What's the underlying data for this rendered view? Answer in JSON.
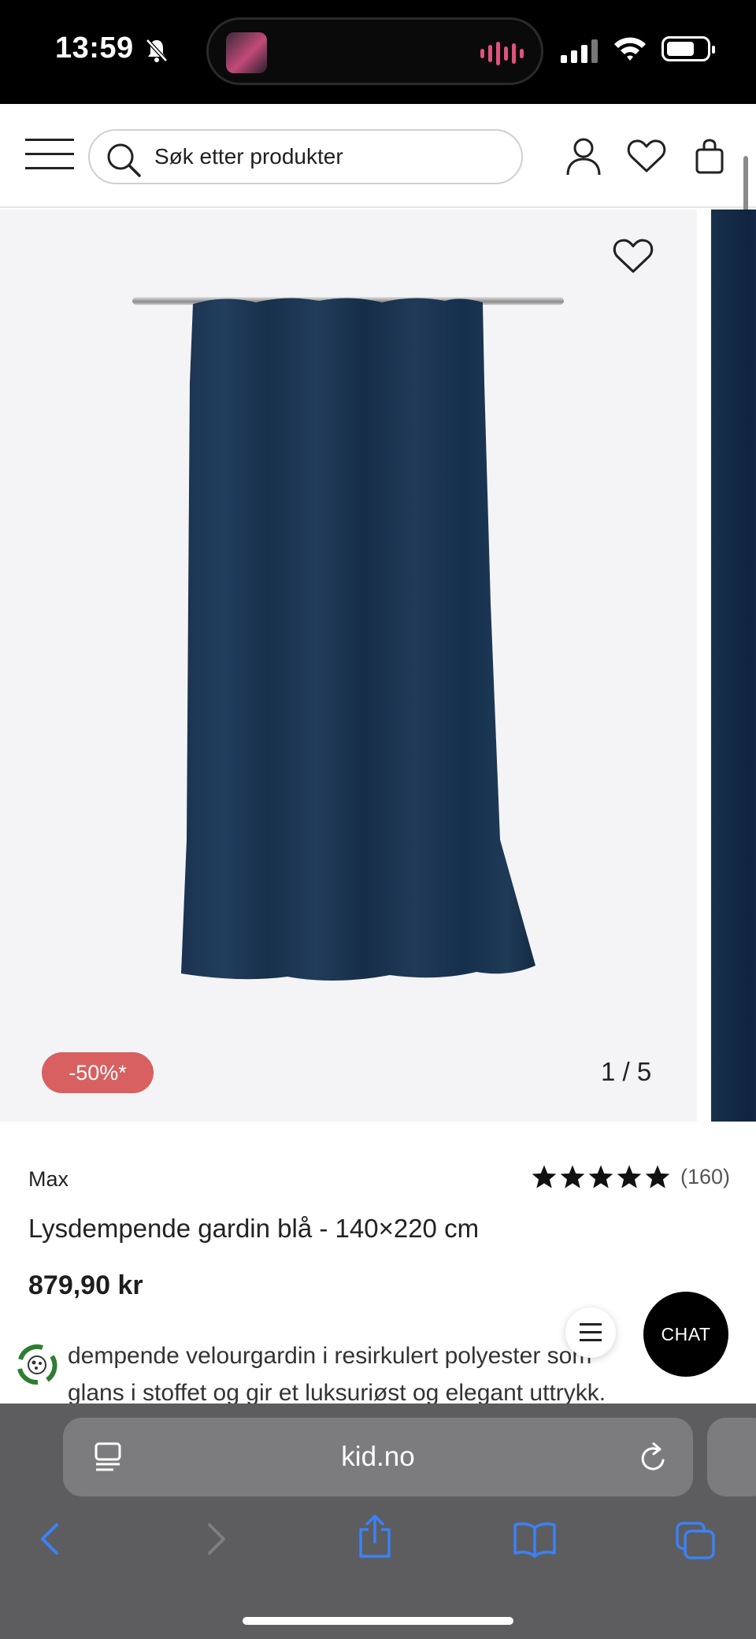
{
  "status_bar": {
    "time": "13:59",
    "icons": [
      "bell-slash-icon",
      "cellular-signal-icon",
      "wifi-icon",
      "battery-icon"
    ]
  },
  "header": {
    "search": {
      "placeholder": "Søk etter produkter"
    },
    "icons": [
      "menu-icon",
      "search-icon",
      "account-icon",
      "heart-icon",
      "bag-icon"
    ]
  },
  "gallery": {
    "discount_badge": "-50%*",
    "counter": "1 / 5",
    "current_index": 1,
    "total": 5
  },
  "product": {
    "brand": "Max",
    "rating": {
      "stars": 5,
      "count": "(160)"
    },
    "title": "Lysdempende gardin blå - 140×220 cm",
    "price": "879,90 kr",
    "description_lines": [
      "dempende velourgardin i resirkulert polyester som",
      "glans i stoffet og gir et luksuriøst og elegant uttrykk."
    ]
  },
  "widgets": {
    "chat_label": "CHAT"
  },
  "browser": {
    "url": "kid.no",
    "toolbar_icons": [
      "back-icon",
      "forward-icon",
      "share-icon",
      "bookmarks-icon",
      "tabs-icon"
    ]
  },
  "colors": {
    "discount_badge": "#d86060",
    "accent_link": "#3b82f6",
    "browser_bar": "#5d5d5f"
  }
}
